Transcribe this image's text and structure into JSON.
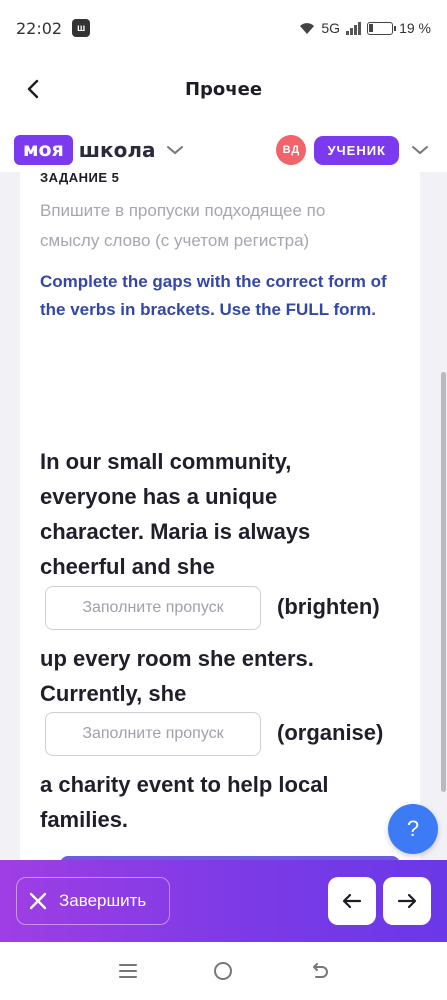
{
  "status_bar": {
    "time": "22:02",
    "network": "5G",
    "battery_percent": "19 %",
    "battery_level": 0.19
  },
  "header": {
    "title": "Прочее",
    "back_icon": "chevron-left-icon"
  },
  "brand": {
    "logo_part1": "моя",
    "logo_part2": "школа",
    "avatar_initials": "ВД",
    "role": "УЧЕНИК",
    "accent_color": "#7b3aed",
    "avatar_color": "#f1646a"
  },
  "task": {
    "label": "ЗАДАНИЕ 5",
    "instruction": "Впишите в пропуски подходящее по смыслу слово (с учетом регистра)",
    "english_task": "Complete the gaps with the correct form of the verbs in brackets. Use the FULL form.",
    "text": {
      "line1": "In our small community,",
      "line2": "everyone has a unique",
      "line3": "character. Maria is always",
      "line4": "cheerful and she",
      "gap1_hint": "(brighten)",
      "line5": "up every room she enters.",
      "line6": "Currently, she",
      "gap2_hint": "(organise)",
      "line7": "a charity event to help local",
      "line8": "families."
    },
    "gap_placeholder": "Заполните пропуск",
    "gap1_value": "",
    "gap2_value": ""
  },
  "help": {
    "label": "?"
  },
  "action_bar": {
    "finish_label": "Завершить",
    "prev_icon": "arrow-left-icon",
    "next_icon": "arrow-right-icon"
  }
}
